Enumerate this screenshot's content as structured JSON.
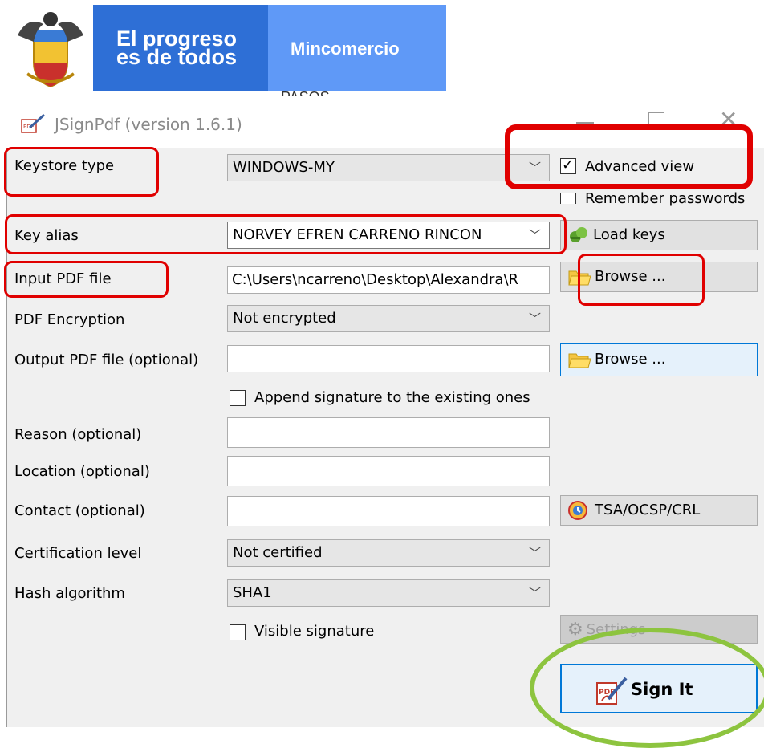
{
  "banner": {
    "line1": "El progreso",
    "line2": "es de todos",
    "ministry": "Mincomercio",
    "behind_text": "PASOS"
  },
  "window": {
    "title": "JSignPdf (version 1.6.1)",
    "icons": [
      "pdf-sign-icon",
      "minimize-icon",
      "maximize-icon",
      "close-icon"
    ]
  },
  "form": {
    "keystore_type_label": "Keystore type",
    "keystore_type_value": "WINDOWS-MY",
    "advanced_view_label": "Advanced view",
    "advanced_view_checked": true,
    "remember_passwords_label": "Remember passwords",
    "remember_passwords_checked": false,
    "key_alias_label": "Key alias",
    "key_alias_value": "NORVEY EFREN CARRENO RINCON",
    "load_keys_label": "Load keys",
    "input_pdf_label": "Input PDF file",
    "input_pdf_value": "C:\\Users\\ncarreno\\Desktop\\Alexandra\\R",
    "browse_label_1": "Browse ...",
    "pdf_encryption_label": "PDF Encryption",
    "pdf_encryption_value": "Not encrypted",
    "output_pdf_label": "Output PDF file (optional)",
    "output_pdf_value": "",
    "browse_label_2": "Browse ...",
    "append_signature_label": "Append signature to the existing ones",
    "append_signature_checked": false,
    "reason_label": "Reason (optional)",
    "reason_value": "",
    "location_label": "Location (optional)",
    "location_value": "",
    "contact_label": "Contact (optional)",
    "contact_value": "",
    "tsa_label": "TSA/OCSP/CRL",
    "cert_level_label": "Certification level",
    "cert_level_value": "Not certified",
    "hash_label": "Hash algorithm",
    "hash_value": "SHA1",
    "visible_signature_label": "Visible signature",
    "visible_signature_checked": false,
    "settings_label": "Settings",
    "sign_label": "Sign It"
  },
  "colors": {
    "banner_dark": "#2e6fd6",
    "banner_light": "#5f99f7",
    "annotation_red": "#e00000",
    "annotation_green": "#8dc43f",
    "window_bg": "#f0f0f0"
  }
}
